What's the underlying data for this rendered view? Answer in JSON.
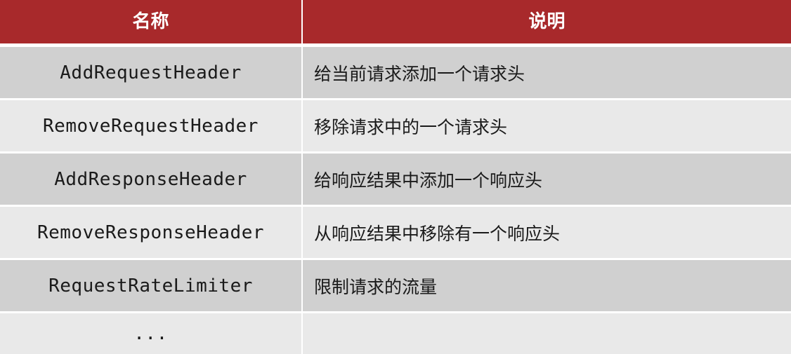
{
  "table": {
    "headers": {
      "name": "名称",
      "description": "说明"
    },
    "rows": [
      {
        "name": "AddRequestHeader",
        "description": "给当前请求添加一个请求头"
      },
      {
        "name": "RemoveRequestHeader",
        "description": "移除请求中的一个请求头"
      },
      {
        "name": "AddResponseHeader",
        "description": "给响应结果中添加一个响应头"
      },
      {
        "name": "RemoveResponseHeader",
        "description": "从响应结果中移除有一个响应头"
      },
      {
        "name": "RequestRateLimiter",
        "description": "限制请求的流量"
      },
      {
        "name": "...",
        "description": ""
      }
    ]
  },
  "colors": {
    "header_background": "#a8292b",
    "header_text": "#ffffff",
    "row_dark": "#d0d0d0",
    "row_light": "#e9e9e9"
  }
}
